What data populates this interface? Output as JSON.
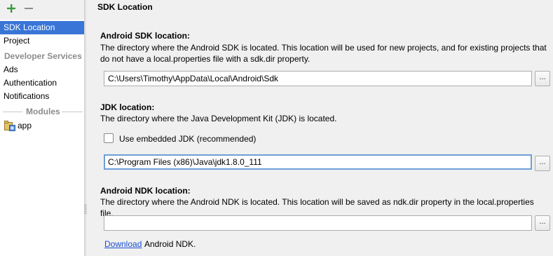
{
  "toolbar": {
    "add_icon": "plus-icon",
    "remove_icon": "minus-icon",
    "add_color": "#3c9a3c"
  },
  "sidebar": {
    "items": [
      {
        "label": "SDK Location",
        "selected": true
      },
      {
        "label": "Project"
      }
    ],
    "developer_services": {
      "header": "Developer Services",
      "items": [
        {
          "label": "Ads"
        },
        {
          "label": "Authentication"
        },
        {
          "label": "Notifications"
        }
      ]
    },
    "modules": {
      "header": "Modules",
      "items": [
        {
          "label": "app",
          "icon": "module-folder-icon"
        }
      ]
    },
    "selection_color": "#3875d7"
  },
  "main": {
    "title": "SDK Location",
    "android_sdk": {
      "title": "Android SDK location:",
      "description": "The directory where the Android SDK is located. This location will be used for new projects, and for existing projects that do not have a local.properties file with a sdk.dir property.",
      "value": "C:\\Users\\Timothy\\AppData\\Local\\Android\\Sdk",
      "browse_label": "..."
    },
    "jdk": {
      "title": "JDK location:",
      "description": "The directory where the Java Development Kit (JDK) is located.",
      "checkbox_label": "Use embedded JDK (recommended)",
      "checkbox_checked": false,
      "value": "C:\\Program Files (x86)\\Java\\jdk1.8.0_111",
      "browse_label": "..."
    },
    "android_ndk": {
      "title": "Android NDK location:",
      "description": "The directory where the Android NDK is located. This location will be saved as ndk.dir property in the local.properties file.",
      "value": "",
      "browse_label": "...",
      "download_link": "Download",
      "download_suffix": "Android NDK."
    }
  }
}
